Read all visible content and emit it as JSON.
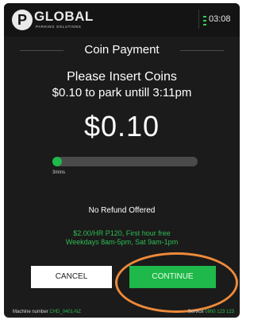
{
  "header": {
    "logo_letter": "P",
    "brand": "GLOBAL",
    "brand_sub": "PARKING SOLUTIONS",
    "time": "03:08"
  },
  "screen": {
    "title": "Coin Payment",
    "instruction": "Please Insert Coins",
    "instruction_detail": "$0.10 to park untill 3:11pm",
    "amount": "$0.10"
  },
  "progress": {
    "label": "3mins",
    "fraction": 0.05
  },
  "info": {
    "refund": "No Refund Offered",
    "rate_line1": "$2.00/HR P120, First hour free",
    "rate_line2": "Weekdays 8am-5pm, Sat 9am-1pm"
  },
  "buttons": {
    "cancel": "CANCEL",
    "continue": "CONTINUE"
  },
  "footer": {
    "machine_label": "Machine number",
    "machine_value": "CHD_0401-NZ",
    "service_label": "Service",
    "service_value": "0800 123 123"
  },
  "colors": {
    "accent": "#1fb84a",
    "highlight_ring": "#ee8a3a",
    "background": "#1b1b1b"
  }
}
